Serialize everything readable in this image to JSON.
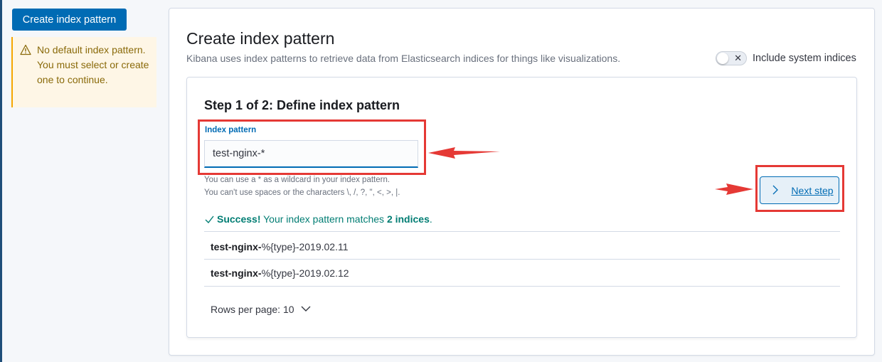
{
  "sidebar": {
    "create_button": "Create index pattern",
    "callout": "No default index pattern. You must select or create one to continue.",
    "callout_icon": "warning-icon"
  },
  "header": {
    "title": "Create index pattern",
    "description": "Kibana uses index patterns to retrieve data from Elasticsearch indices for things like visualizations.",
    "toggle_label": "Include system indices",
    "toggle_on": false
  },
  "step": {
    "title": "Step 1 of 2: Define index pattern",
    "field_label": "Index pattern",
    "input_value": "test-nginx-*",
    "help_line_1": "You can use a * as a wildcard in your index pattern.",
    "help_line_2": "You can't use spaces or the characters \\, /, ?, \", <, >, |.",
    "success_prefix": "Success!",
    "success_middle": " Your index pattern matches ",
    "success_count": "2 indices",
    "success_suffix": ".",
    "next_button": "Next step"
  },
  "indices": [
    {
      "bold": "test-nginx-",
      "rest": "%{type}-2019.02.11"
    },
    {
      "bold": "test-nginx-",
      "rest": "%{type}-2019.02.12"
    }
  ],
  "pagination": {
    "rows_per_page": "Rows per page: 10"
  },
  "colors": {
    "primary": "#006bb4",
    "success": "#017d73",
    "warning": "#f5a700",
    "annotation": "#e53935"
  }
}
